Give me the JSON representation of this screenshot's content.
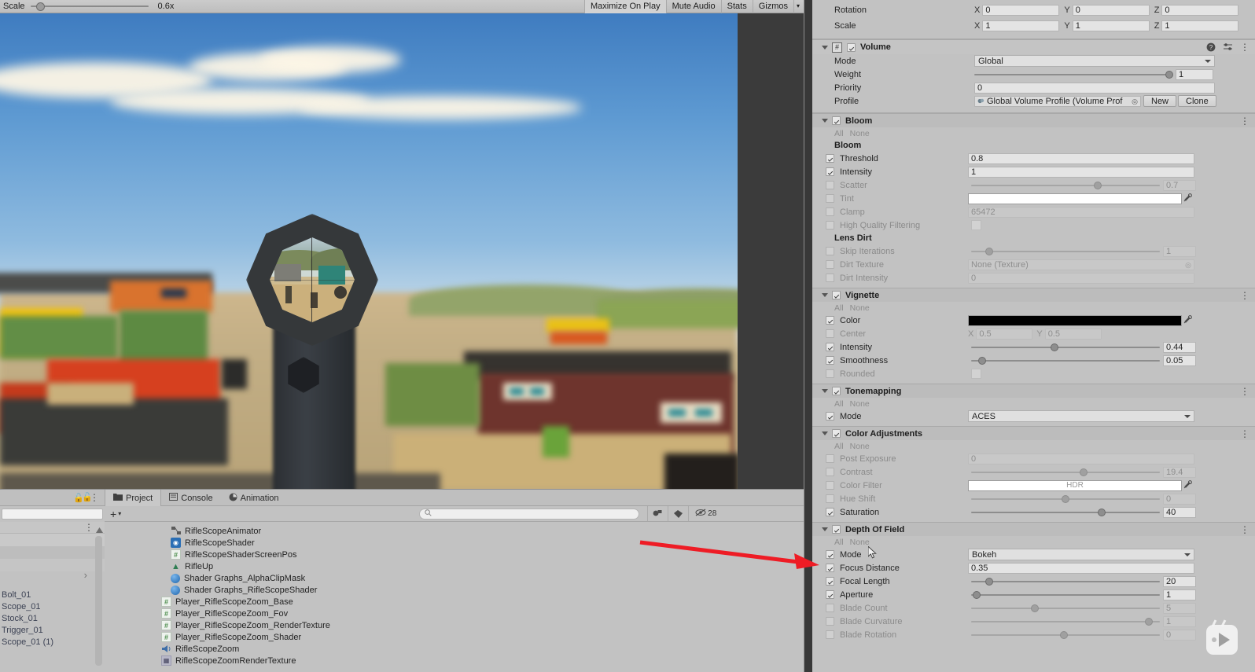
{
  "game_view": {
    "toolbar": {
      "scale_label": "Scale",
      "scale_value": "0.6x",
      "maximize_on_play": "Maximize On Play",
      "mute_audio": "Mute Audio",
      "stats": "Stats",
      "gizmos": "Gizmos",
      "dropdown_arrow": "▾"
    }
  },
  "inspector": {
    "transform": {
      "rotation_label": "Rotation",
      "rotation": {
        "x_axis": "X",
        "x": "0",
        "y_axis": "Y",
        "y": "0",
        "z_axis": "Z",
        "z": "0"
      },
      "scale_label": "Scale",
      "scale": {
        "x_axis": "X",
        "x": "1",
        "y_axis": "Y",
        "y": "1",
        "z_axis": "Z",
        "z": "1"
      }
    },
    "volume": {
      "title": "Volume",
      "enabled": true,
      "help_icon": "?",
      "preset_icon": "preset",
      "menu_icon": "⋮",
      "mode_label": "Mode",
      "mode_value": "Global",
      "weight_label": "Weight",
      "weight_value": "1",
      "priority_label": "Priority",
      "priority_value": "0",
      "profile_label": "Profile",
      "profile_value": "Global Volume Profile (Volume Prof",
      "new_button": "New",
      "clone_button": "Clone"
    },
    "overrides": [
      {
        "title": "Bloom",
        "enabled": true,
        "all_label": "All",
        "none_label": "None",
        "subheaders": [
          {
            "after": -1,
            "text": "Bloom"
          },
          {
            "after": 5,
            "text": "Lens Dirt"
          }
        ],
        "rows": [
          {
            "label": "Threshold",
            "checked": true,
            "type": "text",
            "value": "0.8"
          },
          {
            "label": "Intensity",
            "checked": true,
            "type": "text",
            "value": "1"
          },
          {
            "label": "Scatter",
            "checked": false,
            "type": "slider",
            "value": "0.7",
            "pct": 68
          },
          {
            "label": "Tint",
            "checked": false,
            "type": "color",
            "value": "#ffffff",
            "eyedropper": true
          },
          {
            "label": "Clamp",
            "checked": false,
            "type": "text",
            "value": "65472"
          },
          {
            "label": "High Quality Filtering",
            "checked": false,
            "type": "checkbox",
            "value": ""
          },
          {
            "label": "Skip Iterations",
            "checked": false,
            "type": "slider",
            "value": "1",
            "pct": 8
          },
          {
            "label": "Dirt Texture",
            "checked": false,
            "type": "object",
            "value": "None (Texture)"
          },
          {
            "label": "Dirt Intensity",
            "checked": false,
            "type": "text",
            "value": "0"
          }
        ]
      },
      {
        "title": "Vignette",
        "enabled": true,
        "all_label": "All",
        "none_label": "None",
        "subheaders": [],
        "rows": [
          {
            "label": "Color",
            "checked": true,
            "type": "color",
            "value": "#000000",
            "eyedropper": true
          },
          {
            "label": "Center",
            "checked": false,
            "type": "vector2",
            "x_axis": "X",
            "x": "0.5",
            "y_axis": "Y",
            "y": "0.5"
          },
          {
            "label": "Intensity",
            "checked": true,
            "type": "slider",
            "value": "0.44",
            "pct": 44
          },
          {
            "label": "Smoothness",
            "checked": true,
            "type": "slider",
            "value": "0.05",
            "pct": 4
          },
          {
            "label": "Rounded",
            "checked": false,
            "type": "checkbox",
            "value": ""
          }
        ]
      },
      {
        "title": "Tonemapping",
        "enabled": true,
        "all_label": "All",
        "none_label": "None",
        "subheaders": [],
        "rows": [
          {
            "label": "Mode",
            "checked": true,
            "type": "dropdown",
            "value": "ACES"
          }
        ]
      },
      {
        "title": "Color Adjustments",
        "enabled": true,
        "all_label": "All",
        "none_label": "None",
        "subheaders": [],
        "rows": [
          {
            "label": "Post Exposure",
            "checked": false,
            "type": "text",
            "value": "0"
          },
          {
            "label": "Contrast",
            "checked": false,
            "type": "slider",
            "value": "19.4",
            "pct": 60
          },
          {
            "label": "Color Filter",
            "checked": false,
            "type": "color",
            "value": "#ffffff",
            "hdr_label": "HDR",
            "eyedropper": true
          },
          {
            "label": "Hue Shift",
            "checked": false,
            "type": "slider",
            "value": "0",
            "pct": 50
          },
          {
            "label": "Saturation",
            "checked": true,
            "type": "slider",
            "value": "40",
            "pct": 70
          }
        ]
      },
      {
        "title": "Depth Of Field",
        "enabled": true,
        "all_label": "All",
        "none_label": "None",
        "subheaders": [],
        "rows": [
          {
            "label": "Mode",
            "checked": true,
            "type": "dropdown",
            "value": "Bokeh"
          },
          {
            "label": "Focus Distance",
            "checked": true,
            "type": "text",
            "value": "0.35"
          },
          {
            "label": "Focal Length",
            "checked": true,
            "type": "slider",
            "value": "20",
            "pct": 8
          },
          {
            "label": "Aperture",
            "checked": true,
            "type": "slider",
            "value": "1",
            "pct": 1
          },
          {
            "label": "Blade Count",
            "checked": false,
            "type": "slider",
            "value": "5",
            "pct": 33
          },
          {
            "label": "Blade Curvature",
            "checked": false,
            "type": "slider",
            "value": "1",
            "pct": 96
          },
          {
            "label": "Blade Rotation",
            "checked": false,
            "type": "slider",
            "value": "0",
            "pct": 49
          }
        ]
      }
    ]
  },
  "project_panel": {
    "tabs": [
      {
        "label": "Project",
        "icon": "folder-icon",
        "active": true
      },
      {
        "label": "Console",
        "icon": "console-icon",
        "active": false
      },
      {
        "label": "Animation",
        "icon": "animation-icon",
        "active": false
      }
    ],
    "create_button": "+",
    "create_arrow": "▾",
    "search_placeholder": "",
    "search_value": "",
    "lock_icon": "🔒",
    "visibility_count": "28",
    "assets": [
      {
        "name": "RifleScopeAnimator",
        "icon": "animator-icon",
        "indent": 2
      },
      {
        "name": "RifleScopeShader",
        "icon": "shadergraph-icon",
        "indent": 2
      },
      {
        "name": "RifleScopeShaderScreenPos",
        "icon": "script-icon",
        "indent": 2
      },
      {
        "name": "RifleUp",
        "icon": "terrain-icon",
        "indent": 2
      },
      {
        "name": "Shader Graphs_AlphaClipMask",
        "icon": "material-icon",
        "indent": 2
      },
      {
        "name": "Shader Graphs_RifleScopeShader",
        "icon": "material-icon",
        "indent": 2
      },
      {
        "name": "Player_RifleScopeZoom_Base",
        "icon": "script-icon",
        "indent": 1
      },
      {
        "name": "Player_RifleScopeZoom_Fov",
        "icon": "script-icon",
        "indent": 1
      },
      {
        "name": "Player_RifleScopeZoom_RenderTexture",
        "icon": "script-icon",
        "indent": 1
      },
      {
        "name": "Player_RifleScopeZoom_Shader",
        "icon": "script-icon",
        "indent": 1
      },
      {
        "name": "RifleScopeZoom",
        "icon": "audio-icon",
        "indent": 1
      },
      {
        "name": "RifleScopeZoomRenderTexture",
        "icon": "rendertexture-icon",
        "indent": 1
      }
    ]
  },
  "hierarchy_panel": {
    "lock_icon": "🔓",
    "menu_icon": "⋮",
    "search_value": "",
    "expand_arrow": "›",
    "items": [
      {
        "label": "Bolt_01"
      },
      {
        "label": "Scope_01"
      },
      {
        "label": "Stock_01"
      },
      {
        "label": "Trigger_01"
      },
      {
        "label": "Scope_01 (1)"
      }
    ]
  },
  "annotation": {
    "arrow_color": "#ee1c25",
    "arrow_target": "Mode / Focus Distance row of Depth Of Field"
  }
}
